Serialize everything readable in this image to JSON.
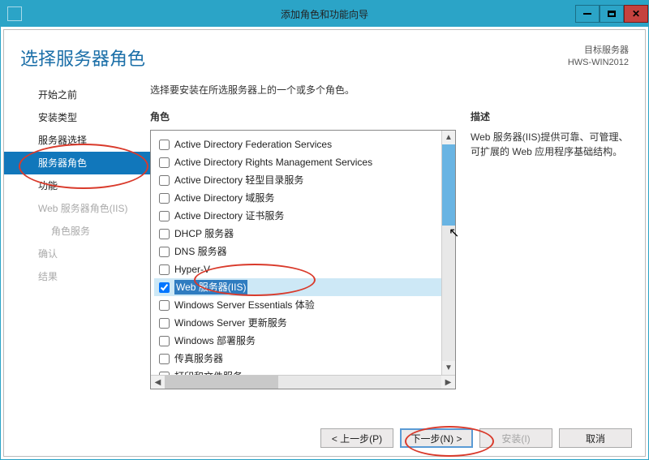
{
  "window": {
    "title": "添加角色和功能向导"
  },
  "page_title": "选择服务器角色",
  "target": {
    "label": "目标服务器",
    "name": "HWS-WIN2012"
  },
  "nav": {
    "items": [
      {
        "label": "开始之前",
        "active": false,
        "disabled": false
      },
      {
        "label": "安装类型",
        "active": false,
        "disabled": false
      },
      {
        "label": "服务器选择",
        "active": false,
        "disabled": false
      },
      {
        "label": "服务器角色",
        "active": true,
        "disabled": false
      },
      {
        "label": "功能",
        "active": false,
        "disabled": false
      },
      {
        "label": "Web 服务器角色(IIS)",
        "active": false,
        "disabled": true
      },
      {
        "label": "角色服务",
        "active": false,
        "disabled": true,
        "indent": true
      },
      {
        "label": "确认",
        "active": false,
        "disabled": true
      },
      {
        "label": "结果",
        "active": false,
        "disabled": true
      }
    ]
  },
  "instruction": "选择要安装在所选服务器上的一个或多个角色。",
  "roles_label": "角色",
  "roles": [
    {
      "label": "Active Directory Federation Services",
      "checked": false
    },
    {
      "label": "Active Directory Rights Management Services",
      "checked": false
    },
    {
      "label": "Active Directory 轻型目录服务",
      "checked": false
    },
    {
      "label": "Active Directory 域服务",
      "checked": false
    },
    {
      "label": "Active Directory 证书服务",
      "checked": false
    },
    {
      "label": "DHCP 服务器",
      "checked": false
    },
    {
      "label": "DNS 服务器",
      "checked": false
    },
    {
      "label": "Hyper-V",
      "checked": false
    },
    {
      "label": "Web 服务器(IIS)",
      "checked": true,
      "selected": true
    },
    {
      "label": "Windows Server Essentials 体验",
      "checked": false
    },
    {
      "label": "Windows Server 更新服务",
      "checked": false
    },
    {
      "label": "Windows 部署服务",
      "checked": false
    },
    {
      "label": "传真服务器",
      "checked": false
    },
    {
      "label": "打印和文件服务",
      "checked": false
    }
  ],
  "description": {
    "label": "描述",
    "text": "Web 服务器(IIS)提供可靠、可管理、可扩展的 Web 应用程序基础结构。"
  },
  "buttons": {
    "prev": "< 上一步(P)",
    "next": "下一步(N) >",
    "install": "安装(I)",
    "cancel": "取消"
  }
}
